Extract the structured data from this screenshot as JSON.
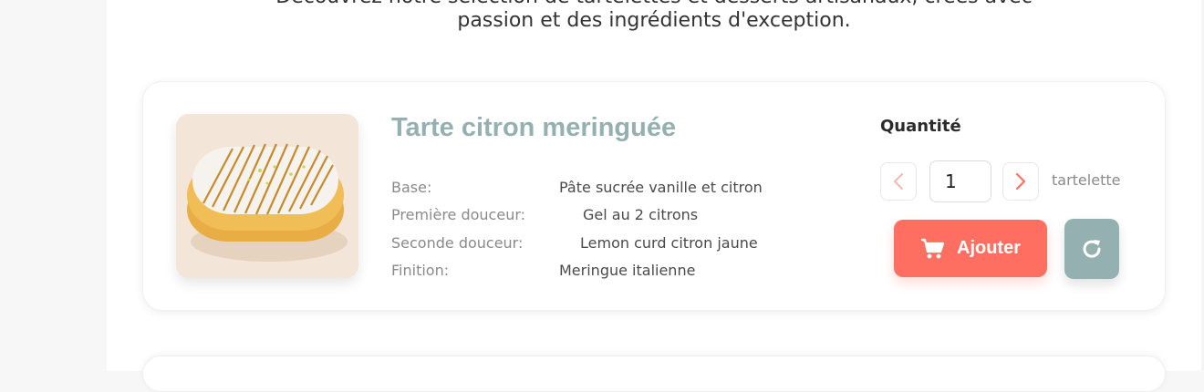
{
  "intro": {
    "line1": "Découvrez notre sélection de tartelettes et desserts artisanaux, créés avec",
    "line2": "passion et des ingrédients d'exception."
  },
  "product": {
    "title": "Tarte citron meringuée",
    "image_alt": "Tarte citron meringuée",
    "specs": [
      {
        "label": "Base:",
        "value": "Pâte sucrée vanille et citron"
      },
      {
        "label": "Première douceur:",
        "value": "Gel au 2 citrons"
      },
      {
        "label": "Seconde douceur:",
        "value": "Lemon curd citron jaune"
      },
      {
        "label": "Finition:",
        "value": "Meringue italienne"
      }
    ]
  },
  "quantity": {
    "label": "Quantité",
    "value": "1",
    "unit": "tartelette"
  },
  "actions": {
    "add_label": "Ajouter"
  },
  "icons": {
    "prev": "chevron-left-icon",
    "next": "chevron-right-icon",
    "cart": "shopping-cart-icon",
    "reset": "refresh-icon"
  },
  "colors": {
    "accent": "#ff6f61",
    "title": "#94b0b0",
    "reset_button": "#94b0b0"
  }
}
